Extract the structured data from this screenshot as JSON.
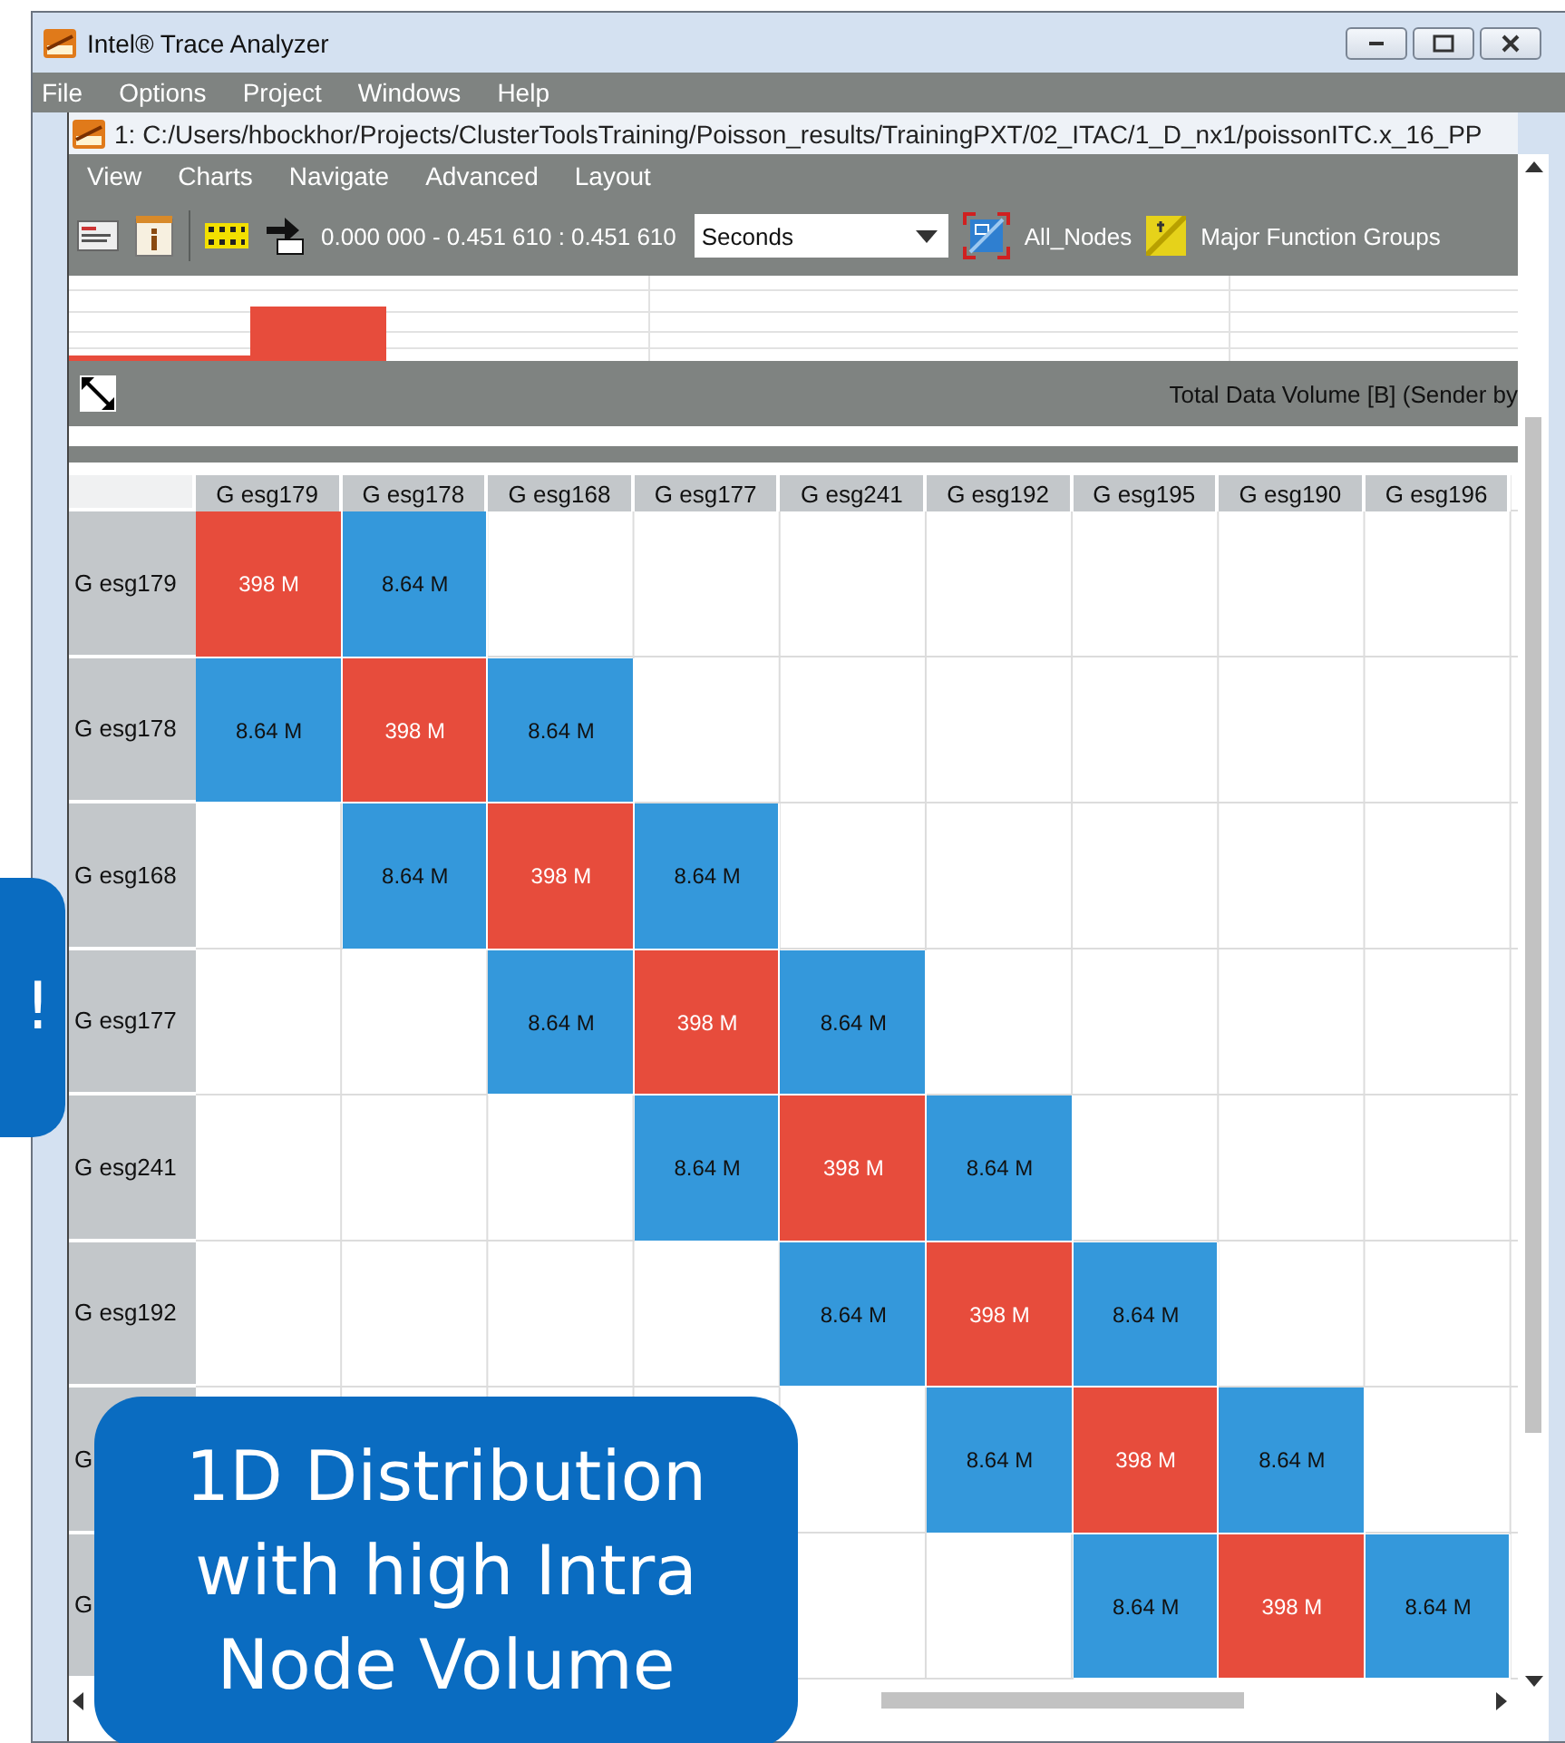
{
  "window": {
    "title": "Intel® Trace Analyzer"
  },
  "menu": [
    "File",
    "Options",
    "Project",
    "Windows",
    "Help"
  ],
  "document": {
    "title": "1: C:/Users/hbockhor/Projects/ClusterToolsTraining/Poisson_results/TrainingPXT/02_ITAC/1_D_nx1/poissonITC.x_16_PP",
    "menu": [
      "View",
      "Charts",
      "Navigate",
      "Advanced",
      "Layout"
    ],
    "toolbar": {
      "time_range": "0.000 000 - 0.451 610 : 0.451 610",
      "unit": "Seconds",
      "group": "All_Nodes",
      "function_group": "Major Function Groups"
    }
  },
  "matrix": {
    "title": "Total Data Volume [B] (Sender by",
    "columns": [
      "G esg179",
      "G esg178",
      "G esg168",
      "G esg177",
      "G esg241",
      "G esg192",
      "G esg195",
      "G esg190",
      "G esg196"
    ],
    "rows": [
      {
        "label": "G esg179",
        "cells": [
          {
            "kind": "high",
            "value": "398 M"
          },
          {
            "kind": "low",
            "value": "8.64 M"
          },
          {
            "kind": "empty"
          },
          {
            "kind": "empty"
          },
          {
            "kind": "empty"
          },
          {
            "kind": "empty"
          },
          {
            "kind": "empty"
          },
          {
            "kind": "empty"
          },
          {
            "kind": "empty"
          }
        ]
      },
      {
        "label": "G esg178",
        "cells": [
          {
            "kind": "low",
            "value": "8.64 M"
          },
          {
            "kind": "high",
            "value": "398 M"
          },
          {
            "kind": "low",
            "value": "8.64 M"
          },
          {
            "kind": "empty"
          },
          {
            "kind": "empty"
          },
          {
            "kind": "empty"
          },
          {
            "kind": "empty"
          },
          {
            "kind": "empty"
          },
          {
            "kind": "empty"
          }
        ]
      },
      {
        "label": "G esg168",
        "cells": [
          {
            "kind": "empty"
          },
          {
            "kind": "low",
            "value": "8.64 M"
          },
          {
            "kind": "high",
            "value": "398 M"
          },
          {
            "kind": "low",
            "value": "8.64 M"
          },
          {
            "kind": "empty"
          },
          {
            "kind": "empty"
          },
          {
            "kind": "empty"
          },
          {
            "kind": "empty"
          },
          {
            "kind": "empty"
          }
        ]
      },
      {
        "label": "G esg177",
        "cells": [
          {
            "kind": "empty"
          },
          {
            "kind": "empty"
          },
          {
            "kind": "low",
            "value": "8.64 M"
          },
          {
            "kind": "high",
            "value": "398 M"
          },
          {
            "kind": "low",
            "value": "8.64 M"
          },
          {
            "kind": "empty"
          },
          {
            "kind": "empty"
          },
          {
            "kind": "empty"
          },
          {
            "kind": "empty"
          }
        ]
      },
      {
        "label": "G esg241",
        "cells": [
          {
            "kind": "empty"
          },
          {
            "kind": "empty"
          },
          {
            "kind": "empty"
          },
          {
            "kind": "low",
            "value": "8.64 M"
          },
          {
            "kind": "high",
            "value": "398 M"
          },
          {
            "kind": "low",
            "value": "8.64 M"
          },
          {
            "kind": "empty"
          },
          {
            "kind": "empty"
          },
          {
            "kind": "empty"
          }
        ]
      },
      {
        "label": "G esg192",
        "cells": [
          {
            "kind": "empty"
          },
          {
            "kind": "empty"
          },
          {
            "kind": "empty"
          },
          {
            "kind": "empty"
          },
          {
            "kind": "low",
            "value": "8.64 M"
          },
          {
            "kind": "high",
            "value": "398 M"
          },
          {
            "kind": "low",
            "value": "8.64 M"
          },
          {
            "kind": "empty"
          },
          {
            "kind": "empty"
          }
        ]
      },
      {
        "label": "G",
        "cells": [
          {
            "kind": "empty"
          },
          {
            "kind": "empty"
          },
          {
            "kind": "empty"
          },
          {
            "kind": "empty"
          },
          {
            "kind": "empty"
          },
          {
            "kind": "low",
            "value": "8.64 M"
          },
          {
            "kind": "high",
            "value": "398 M"
          },
          {
            "kind": "low",
            "value": "8.64 M"
          },
          {
            "kind": "empty"
          }
        ]
      },
      {
        "label": "G",
        "cells": [
          {
            "kind": "empty"
          },
          {
            "kind": "empty"
          },
          {
            "kind": "empty"
          },
          {
            "kind": "empty"
          },
          {
            "kind": "empty"
          },
          {
            "kind": "empty"
          },
          {
            "kind": "low",
            "value": "8.64 M"
          },
          {
            "kind": "high",
            "value": "398 M"
          },
          {
            "kind": "low",
            "value": "8.64 M"
          }
        ]
      }
    ]
  },
  "callouts": [
    {
      "text": "!"
    },
    {
      "text": "1D Distribution with high Intra Node Volume"
    }
  ]
}
